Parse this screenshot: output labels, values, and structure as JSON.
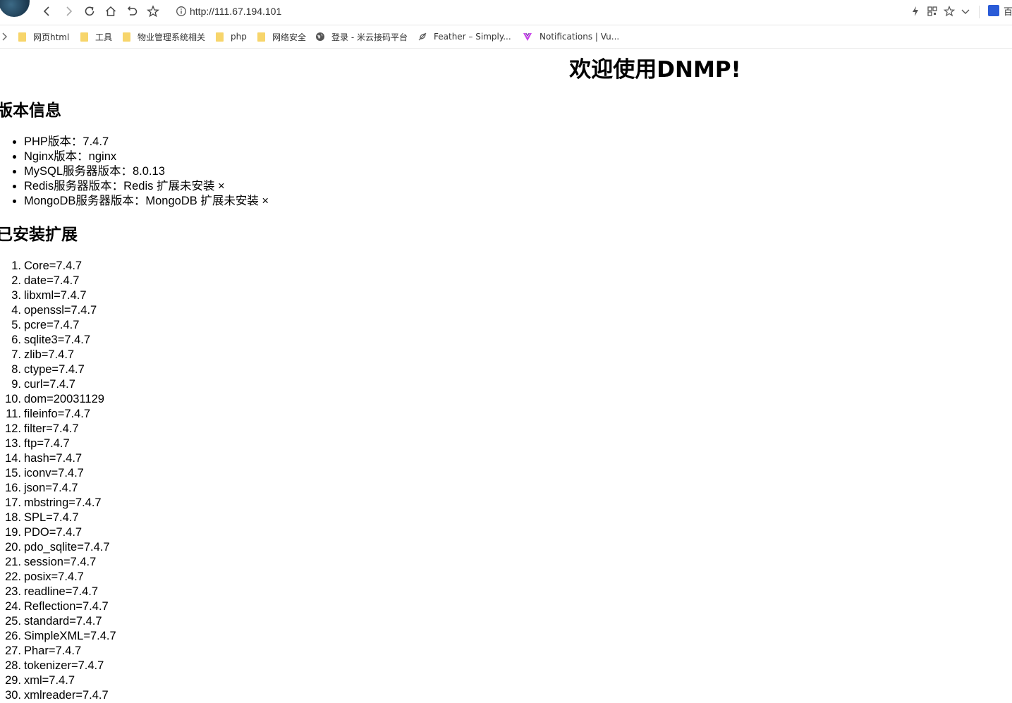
{
  "browser": {
    "url": "http://111.67.194.101",
    "cut_label": "百"
  },
  "bookmarks": [
    {
      "label": "网页html",
      "icon": "folder-icon"
    },
    {
      "label": "工具",
      "icon": "folder-icon"
    },
    {
      "label": "物业管理系统相关",
      "icon": "folder-icon"
    },
    {
      "label": "php",
      "icon": "folder-icon"
    },
    {
      "label": "网络安全",
      "icon": "folder-icon"
    },
    {
      "label": "登录 - 米云接码平台",
      "icon": "globe-icon"
    },
    {
      "label": "Feather – Simply...",
      "icon": "feather-icon"
    },
    {
      "label": "Notifications | Vu...",
      "icon": "vue-icon"
    }
  ],
  "page": {
    "title": "欢迎使用DNMP!",
    "version_heading": "版本信息",
    "versions": [
      "PHP版本：7.4.7",
      "Nginx版本：nginx",
      "MySQL服务器版本：8.0.13",
      "Redis服务器版本：Redis 扩展未安装 ×",
      "MongoDB服务器版本：MongoDB 扩展未安装 ×"
    ],
    "extensions_heading": "已安装扩展",
    "extensions": [
      "Core=7.4.7",
      "date=7.4.7",
      "libxml=7.4.7",
      "openssl=7.4.7",
      "pcre=7.4.7",
      "sqlite3=7.4.7",
      "zlib=7.4.7",
      "ctype=7.4.7",
      "curl=7.4.7",
      "dom=20031129",
      "fileinfo=7.4.7",
      "filter=7.4.7",
      "ftp=7.4.7",
      "hash=7.4.7",
      "iconv=7.4.7",
      "json=7.4.7",
      "mbstring=7.4.7",
      "SPL=7.4.7",
      "PDO=7.4.7",
      "pdo_sqlite=7.4.7",
      "session=7.4.7",
      "posix=7.4.7",
      "readline=7.4.7",
      "Reflection=7.4.7",
      "standard=7.4.7",
      "SimpleXML=7.4.7",
      "Phar=7.4.7",
      "tokenizer=7.4.7",
      "xml=7.4.7",
      "xmlreader=7.4.7"
    ]
  }
}
